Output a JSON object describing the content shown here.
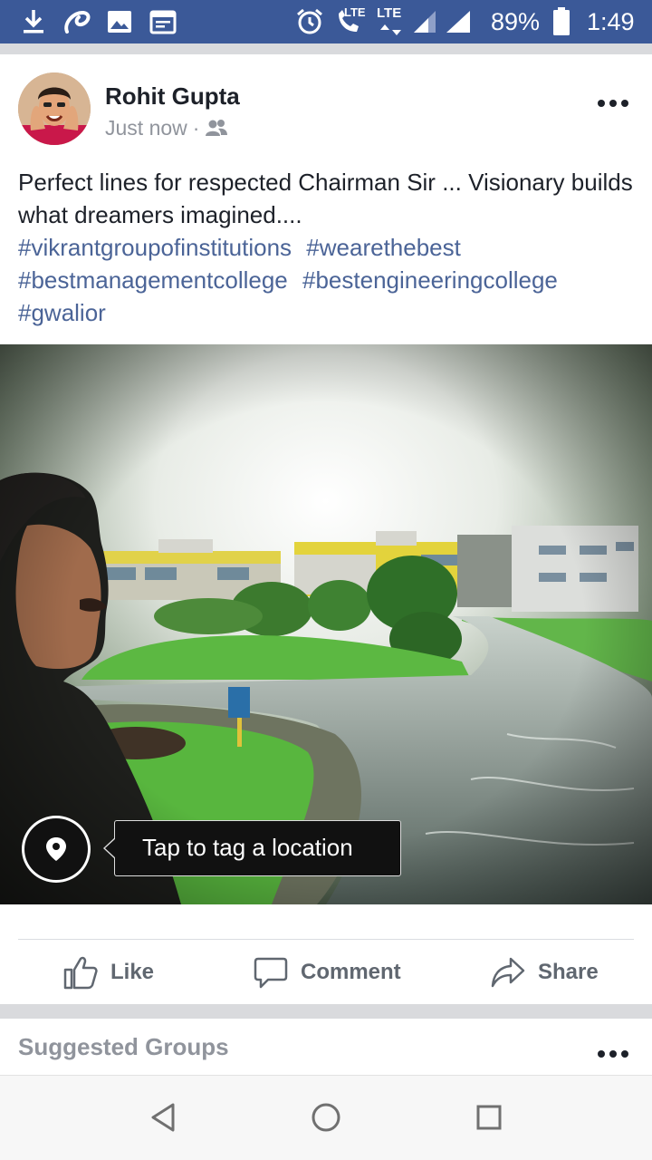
{
  "status_bar": {
    "battery": "89%",
    "time": "1:49",
    "lte1": "LTE",
    "lte2": "LTE",
    "icons": [
      "download-icon",
      "airtel-icon",
      "gallery-icon",
      "calendar-icon",
      "alarm-icon",
      "volte-call-icon",
      "lte-data-icon",
      "signal-icon",
      "signal-icon",
      "battery-icon"
    ]
  },
  "post": {
    "author": "Rohit Gupta",
    "time": "Just now",
    "separator": "·",
    "audience_icon": "friends-icon",
    "text": "Perfect lines for respected Chairman Sir ... Visionary builds what dreamers imagined....",
    "hashtags": [
      "#vikrantgroupofinstitutions",
      "#wearethebest",
      "#bestmanagementcollege",
      "#bestengineeringcollege",
      "#gwalior"
    ],
    "location_tip": "Tap to tag a location"
  },
  "actions": {
    "like": "Like",
    "comment": "Comment",
    "share": "Share"
  },
  "suggested": {
    "title": "Suggested Groups"
  },
  "colors": {
    "status_bar": "#3b5998",
    "hashtag": "#4b6497",
    "action_text": "#606770"
  }
}
